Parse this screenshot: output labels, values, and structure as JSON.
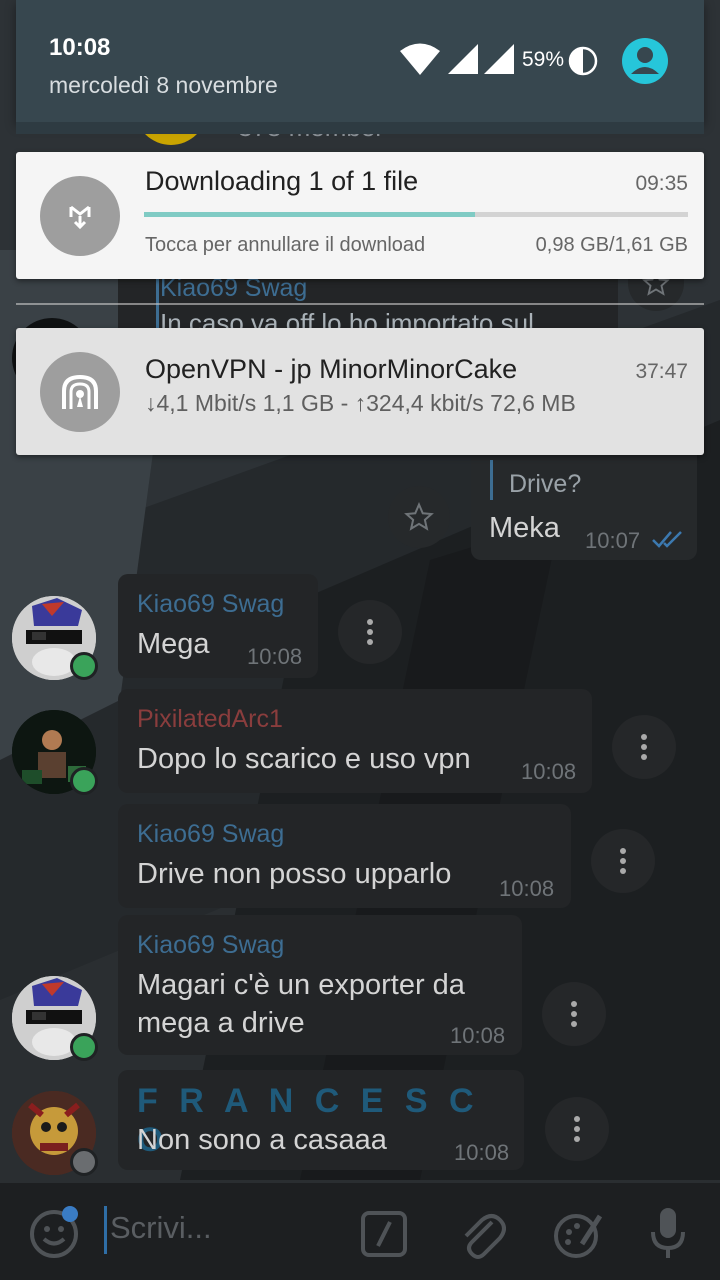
{
  "status_bar": {
    "time": "10:08",
    "date": "mercoledì 8 novembre",
    "battery": "59%"
  },
  "notifications": {
    "download": {
      "title": "Downloading 1 of 1 file",
      "time": "09:35",
      "subtext": "Tocca per annullare il download",
      "size_info": "0,98 GB/1,61 GB",
      "progress": 0.608
    },
    "vpn": {
      "title": "OpenVPN - jp MinorMinorCake",
      "time": "37:47",
      "stats": "↓4,1 Mbit/s 1,1 GB - ↑324,4 kbit/s 72,6 MB"
    }
  },
  "chat": {
    "behind": {
      "top_name": "378 member",
      "reply_name": "Kiao69 Swag",
      "reply_text": "In caso va off lo ho importato sul"
    },
    "outgoing": {
      "quote": "Drive?",
      "text": "Meka",
      "time": "10:07"
    },
    "messages": [
      {
        "sender": "Kiao69 Swag",
        "text": "Mega",
        "time": "10:08"
      },
      {
        "sender": "PixilatedArc1",
        "text": "Dopo lo scarico e uso vpn",
        "time": "10:08"
      },
      {
        "sender": "Kiao69 Swag",
        "text": "Drive non posso upparlo",
        "time": "10:08"
      },
      {
        "sender": "Kiao69 Swag",
        "text_line1": "Magari c'è un exporter da",
        "text_line2": "mega a drive",
        "time": "10:08"
      },
      {
        "sender": "F R A N C E S C O",
        "text": "Non sono a casaaa",
        "time": "10:08"
      }
    ]
  },
  "input": {
    "placeholder": "Scrivi..."
  },
  "colors": {
    "shade_header": "#37474f",
    "accent_teal": "#26c6da",
    "progress": "#80cbc4",
    "bubble": "#232527",
    "sender_blue": "#3d6d92",
    "sender_red": "#8a3d3d"
  },
  "icons": [
    "wifi-icon",
    "signal-icon",
    "battery-icon",
    "account-icon",
    "mega-download-icon",
    "openvpn-icon",
    "star-icon",
    "more-options-icon",
    "emoji-icon",
    "slash-command-icon",
    "attach-icon",
    "sticker-icon",
    "microphone-icon",
    "double-check-icon"
  ]
}
